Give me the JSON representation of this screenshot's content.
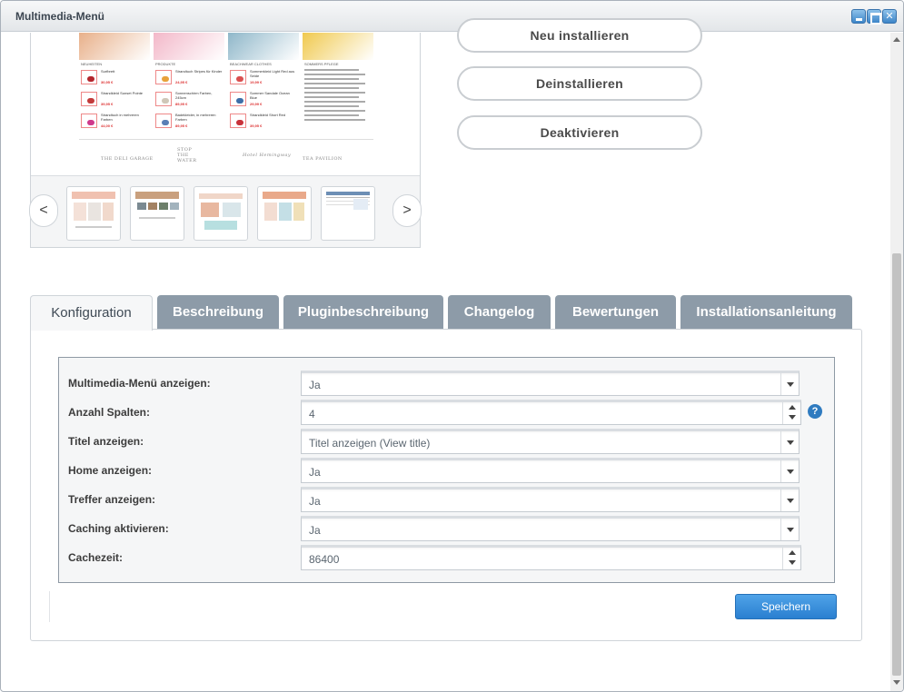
{
  "window": {
    "title": "Multimedia-Menü"
  },
  "preview": {
    "columns": [
      {
        "heading": "NEUHEITEN",
        "hero_color": "#e8b08a",
        "items": [
          {
            "title": "Surfbrett",
            "price": "30,95 €",
            "color": "#b3262d"
          },
          {
            "title": "Strandkleid Sunset Pointe",
            "price": "39,95 €",
            "color": "#c23b3b"
          },
          {
            "title": "Strandtuch in mehreren Farben",
            "price": "44,00 €",
            "color": "#cf3a8c"
          }
        ]
      },
      {
        "heading": "PRODUKTE",
        "hero_color": "#f3b8c9",
        "items": [
          {
            "title": "Strandtuch Stripes für Kinder",
            "price": "24,95 €",
            "color": "#e8a23a"
          },
          {
            "title": "Sonnenschirm Farben, 245cm",
            "price": "89,95 €",
            "color": "#cfc7b8"
          },
          {
            "title": "Badekleider, in mehreren Farben",
            "price": "89,95 €",
            "color": "#5a7fb5"
          }
        ]
      },
      {
        "heading": "BEACHWEAR CLOTHES",
        "hero_color": "#8fb7c9",
        "items": [
          {
            "title": "Sommerkleid Light Red aus Seide",
            "price": "19,99 €",
            "color": "#d94f4f"
          },
          {
            "title": "Sommer Sandale Ocean Blue",
            "price": "29,99 €",
            "color": "#3d6ea8"
          },
          {
            "title": "Strandkleid Short Red",
            "price": "39,95 €",
            "color": "#c8323a"
          }
        ]
      },
      {
        "heading": "SOMMERS PFLEGE",
        "hero_color": "#f0c94f",
        "items": []
      }
    ],
    "logos": [
      "THE DELI GARAGE",
      "STOP THE WATER",
      "Hotel Hemingway",
      "TEA PAVILION"
    ],
    "nav_prev": "<",
    "nav_next": ">"
  },
  "actions": {
    "reinstall": "Neu installieren",
    "uninstall": "Deinstallieren",
    "deactivate": "Deaktivieren"
  },
  "tabs": [
    {
      "label": "Konfiguration",
      "active": true
    },
    {
      "label": "Beschreibung",
      "active": false
    },
    {
      "label": "Pluginbeschreibung",
      "active": false
    },
    {
      "label": "Changelog",
      "active": false
    },
    {
      "label": "Bewertungen",
      "active": false
    },
    {
      "label": "Installationsanleitung",
      "active": false
    }
  ],
  "form": {
    "fields": [
      {
        "label": "Multimedia-Menü anzeigen:",
        "type": "select",
        "value": "Ja"
      },
      {
        "label": "Anzahl Spalten:",
        "type": "number",
        "value": "4",
        "help": "?"
      },
      {
        "label": "Titel anzeigen:",
        "type": "select",
        "value": "Titel anzeigen (View title)"
      },
      {
        "label": "Home anzeigen:",
        "type": "select",
        "value": "Ja"
      },
      {
        "label": "Treffer anzeigen:",
        "type": "select",
        "value": "Ja"
      },
      {
        "label": "Caching aktivieren:",
        "type": "select",
        "value": "Ja"
      },
      {
        "label": "Cachezeit:",
        "type": "number",
        "value": "86400"
      }
    ],
    "save_label": "Speichern"
  },
  "colors": {
    "tab_inactive": "#8d9ba8",
    "save_button": "#2a7fd0",
    "help_icon": "#2f7bc0"
  }
}
